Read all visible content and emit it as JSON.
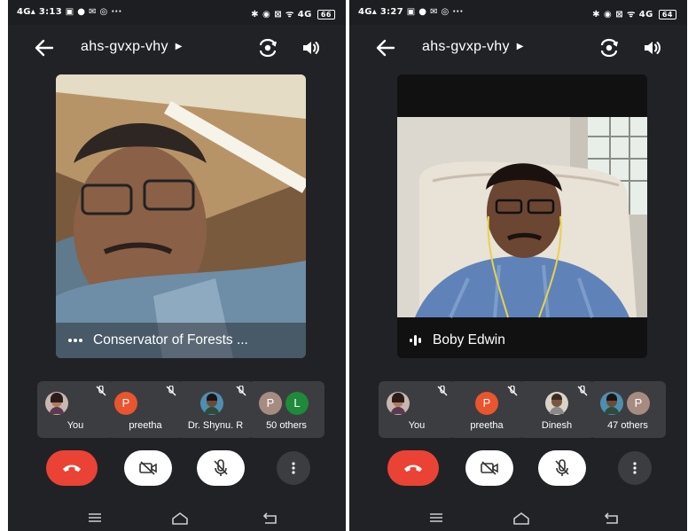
{
  "screens": [
    {
      "status_time": "3:13",
      "status_right": "✱ ◉ ⊠ ᯤ 4G",
      "battery": "66",
      "meeting_code": "ahs-gvxp-vhy",
      "featured_name": "Conservator of Forests ...",
      "participants": [
        {
          "name": "You"
        },
        {
          "name": "preetha",
          "initial": "P"
        },
        {
          "name": "Dr. Shynu. R"
        },
        {
          "name": "50 others",
          "initials": [
            "P",
            "L"
          ]
        }
      ]
    },
    {
      "status_time": "3:27",
      "status_right": "✱ ◉ ⊠ ᯤ 4G",
      "battery": "64",
      "meeting_code": "ahs-gvxp-vhy",
      "featured_name": "Boby Edwin",
      "participants": [
        {
          "name": "You"
        },
        {
          "name": "preetha",
          "initial": "P"
        },
        {
          "name": "Dinesh"
        },
        {
          "name": "47 others",
          "initial": "P"
        }
      ]
    }
  ],
  "colors": {
    "background": "#212226",
    "tile": "#3c3d41",
    "end_call": "#ea4335",
    "avatar_p": "#e8552f",
    "avatar_l": "#1f8a3a",
    "avatar_grey_p": "#a68b80"
  },
  "icons": [
    "back-arrow-icon",
    "caret-right-icon",
    "switch-camera-icon",
    "speaker-icon",
    "mic-off-icon",
    "end-call-icon",
    "camera-off-icon",
    "more-vert-icon",
    "menu-icon",
    "home-icon",
    "back-icon",
    "more-horiz-icon",
    "audio-level-icon"
  ]
}
